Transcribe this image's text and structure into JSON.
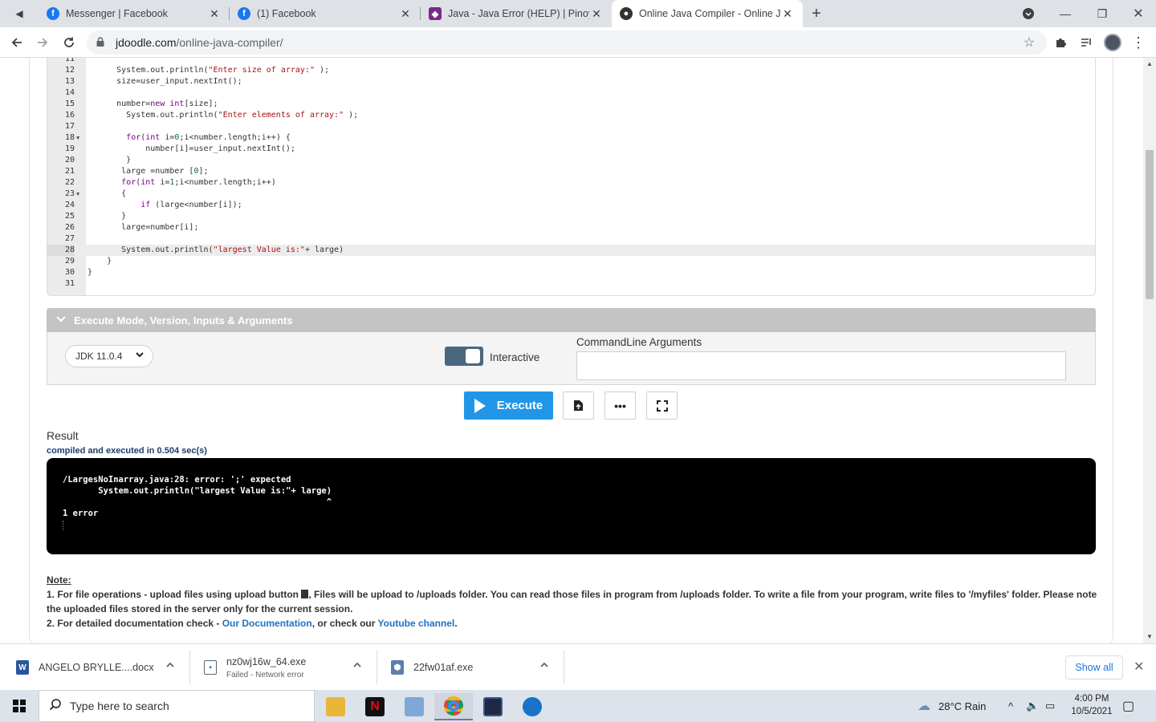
{
  "browser": {
    "tabs": [
      {
        "title": "Messenger | Facebook",
        "favicon": "facebook-icon"
      },
      {
        "title": "(1) Facebook",
        "favicon": "facebook-icon"
      },
      {
        "title": "Java - Java Error (HELP) | Pinoy In",
        "favicon": "shield-icon"
      },
      {
        "title": "Online Java Compiler - Online Ja",
        "favicon": "jdoodle-icon",
        "active": true
      }
    ],
    "url_host": "jdoodle.com",
    "url_path": "/online-java-compiler/"
  },
  "editor": {
    "lines": [
      {
        "n": "11",
        "fold": false,
        "html": ""
      },
      {
        "n": "12",
        "fold": false,
        "html": "      System.out.println(<span class='str'>\"Enter size of array:\"</span> );"
      },
      {
        "n": "13",
        "fold": false,
        "html": "      size=user_input.nextInt();"
      },
      {
        "n": "14",
        "fold": false,
        "html": ""
      },
      {
        "n": "15",
        "fold": false,
        "html": "      number=<span class='kw'>new</span> <span class='kw'>int</span>[size];"
      },
      {
        "n": "16",
        "fold": false,
        "html": "        System.out.println(<span class='str'>\"Enter elements of array:\"</span> );"
      },
      {
        "n": "17",
        "fold": false,
        "html": ""
      },
      {
        "n": "18",
        "fold": true,
        "html": "        <span class='kw'>for</span>(<span class='kw'>int</span> i=<span class='num'>0</span>;i&lt;number.length;i++) {"
      },
      {
        "n": "19",
        "fold": false,
        "html": "            number[i]=user_input.nextInt();"
      },
      {
        "n": "20",
        "fold": false,
        "html": "        }"
      },
      {
        "n": "21",
        "fold": false,
        "html": "       large =number [<span class='num'>0</span>];"
      },
      {
        "n": "22",
        "fold": false,
        "html": "       <span class='kw'>for</span>(<span class='kw'>int</span> i=<span class='num'>1</span>;i&lt;number.length;i++)"
      },
      {
        "n": "23",
        "fold": true,
        "html": "       {"
      },
      {
        "n": "24",
        "fold": false,
        "html": "           <span class='kw'>if</span> (large&lt;number[i]);"
      },
      {
        "n": "25",
        "fold": false,
        "html": "       }"
      },
      {
        "n": "26",
        "fold": false,
        "html": "       large=number[i];"
      },
      {
        "n": "27",
        "fold": false,
        "html": ""
      },
      {
        "n": "28",
        "fold": false,
        "active": true,
        "html": "       System.out.println(<span class='str'>\"largest Value is:\"</span>+ large)"
      },
      {
        "n": "29",
        "fold": false,
        "html": "    }"
      },
      {
        "n": "30",
        "fold": false,
        "html": "}"
      },
      {
        "n": "31",
        "fold": false,
        "html": ""
      }
    ]
  },
  "exec": {
    "section_title": "Execute Mode, Version, Inputs & Arguments",
    "jdk_version": "JDK 11.0.4",
    "interactive_label": "Interactive",
    "interactive_on": true,
    "cla_label": "CommandLine Arguments",
    "cla_value": "",
    "execute_label": "Execute"
  },
  "result": {
    "title": "Result",
    "subtitle": "compiled and executed in 0.504 sec(s)",
    "output": [
      "/LargesNoInarray.java:28: error: ';' expected",
      "       System.out.println(\"largest Value is:\"+ large)",
      "                                                    ^",
      "1 error"
    ]
  },
  "note": {
    "label": "Note:",
    "line1a": "1. For file operations - upload files using upload button",
    "line1b": ", Files will be upload to /uploads folder. You can read those files in program from /uploads folder. To write a file from your program, write files to '/myfiles' folder. Please note the uploaded files stored in the server only for the current session.",
    "line2a": "2. For detailed documentation check - ",
    "doc_link": "Our Documentation",
    "line2b": ", or check our ",
    "yt_link": "Youtube channel",
    "line2c": "."
  },
  "downloads": {
    "items": [
      {
        "name": "ANGELO BRYLLE....docx",
        "status": "",
        "icon": "word-icon"
      },
      {
        "name": "nz0wj16w_64.exe",
        "status": "Failed - Network error",
        "icon": "exe-icon"
      },
      {
        "name": "22fw01af.exe",
        "status": "",
        "icon": "installer-icon"
      }
    ],
    "show_all": "Show all"
  },
  "taskbar": {
    "search_placeholder": "Type here to search",
    "weather": "28°C  Rain",
    "time": "4:00 PM",
    "date": "10/5/2021"
  },
  "colors": {
    "accent": "#2196e6",
    "exec_bar": "#c4c4c4",
    "link": "#1e73be"
  }
}
